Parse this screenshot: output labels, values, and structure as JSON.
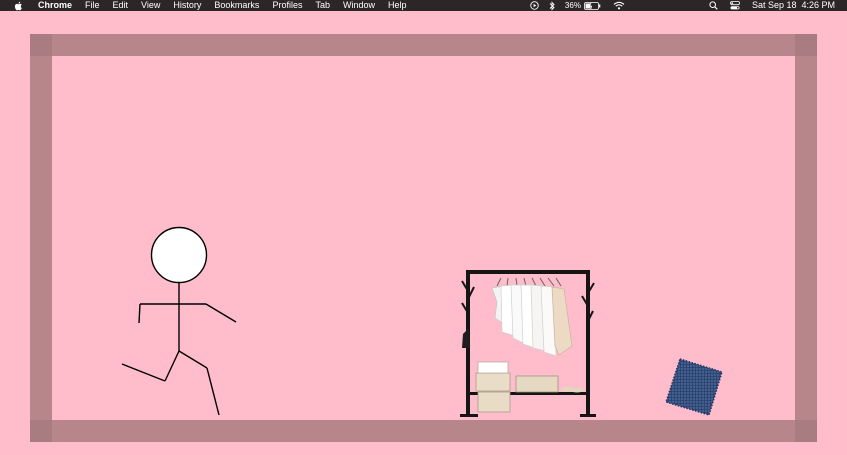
{
  "menubar": {
    "app": "Chrome",
    "items": [
      "File",
      "Edit",
      "View",
      "History",
      "Bookmarks",
      "Profiles",
      "Tab",
      "Window",
      "Help"
    ],
    "battery": "36%",
    "datetime": "Sat Sep 18  4:26 PM"
  },
  "scene": {
    "background_color": "#ffbccb",
    "wall_color": "#b6868b",
    "objects": [
      "stick-figure",
      "clothes-rack",
      "blue-rug"
    ]
  }
}
